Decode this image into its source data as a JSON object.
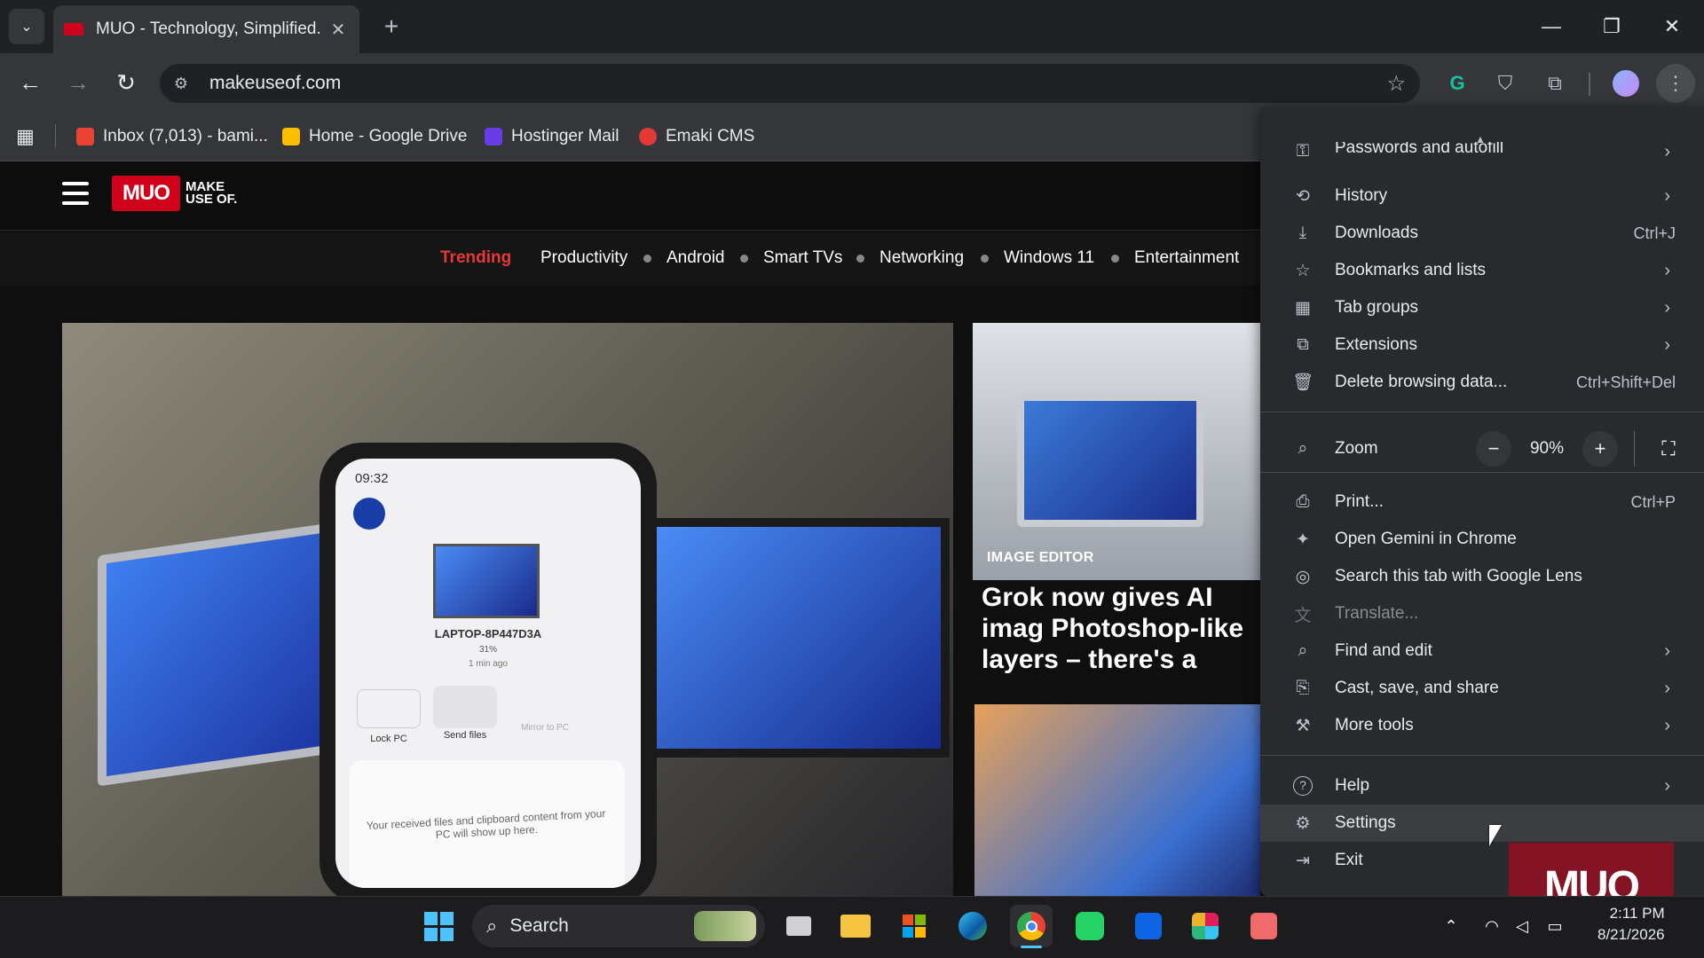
{
  "browser": {
    "tab_title": "MUO - Technology, Simplified.",
    "tab_close": "✕",
    "new_tab": "+",
    "url": "makeuseof.com",
    "window": {
      "minimize": "—",
      "restore": "❐",
      "close": "✕"
    }
  },
  "bookmarks": [
    {
      "label": "Inbox (7,013) - bami...",
      "color": "#ea4335"
    },
    {
      "label": "Home - Google Drive",
      "color": "#fbbc04"
    },
    {
      "label": "Hostinger Mail",
      "color": "#673de6"
    },
    {
      "label": "Emaki CMS",
      "color": "#e53935"
    }
  ],
  "site": {
    "logo_box": "MUO",
    "logo_text": "MAKE USE OF.",
    "nav": [
      "Trending",
      "Productivity",
      "Android",
      "Smart TVs",
      "Networking",
      "Windows 11",
      "Entertainment"
    ],
    "trending_color": "#e53935",
    "card1": {
      "tag": "IMAGE EDITOR",
      "title": "Grok now gives AI imag Photoshop-like layers – there's a catch"
    },
    "phone": {
      "time": "09:32",
      "device": "LAPTOP-8P447D3A",
      "battery": "31%",
      "ago": "1 min ago",
      "lock": "Lock PC",
      "send": "Send files",
      "mirror": "Mirror to PC",
      "received": "Your received files and clipboard content from your PC will show up here."
    }
  },
  "menu": {
    "partial_item": "Passwords and autofill",
    "items": [
      {
        "label": "History",
        "icon": "history-icon",
        "glyph": "⟲",
        "arrow": "›"
      },
      {
        "label": "Downloads",
        "icon": "download-icon",
        "glyph": "⤓",
        "shortcut": "Ctrl+J"
      },
      {
        "label": "Bookmarks and lists",
        "icon": "star-icon",
        "glyph": "☆",
        "arrow": "›"
      },
      {
        "label": "Tab groups",
        "icon": "grid-icon",
        "glyph": "▦",
        "arrow": "›"
      },
      {
        "label": "Extensions",
        "icon": "puzzle-icon",
        "glyph": "⧉",
        "arrow": "›"
      },
      {
        "label": "Delete browsing data...",
        "icon": "trash-icon",
        "glyph": "🗑",
        "shortcut": "Ctrl+Shift+Del"
      }
    ],
    "zoom": {
      "label": "Zoom",
      "minus": "−",
      "value": "90%",
      "plus": "+",
      "fullscreen": "⛶"
    },
    "items2": [
      {
        "label": "Print...",
        "icon": "printer-icon",
        "glyph": "⎙",
        "shortcut": "Ctrl+P"
      },
      {
        "label": "Open Gemini in Chrome",
        "icon": "sparkle-icon",
        "glyph": "✦"
      },
      {
        "label": "Search this tab with Google Lens",
        "icon": "lens-icon",
        "glyph": "◎"
      },
      {
        "label": "Translate...",
        "icon": "translate-icon",
        "glyph": "文",
        "disabled": true
      },
      {
        "label": "Find and edit",
        "icon": "find-icon",
        "glyph": "⌕",
        "arrow": "›"
      },
      {
        "label": "Cast, save, and share",
        "icon": "cast-icon",
        "glyph": "⎘",
        "arrow": "›"
      },
      {
        "label": "More tools",
        "icon": "toolbox-icon",
        "glyph": "⚒",
        "arrow": "›"
      }
    ],
    "items3": [
      {
        "label": "Help",
        "icon": "help-icon",
        "glyph": "?",
        "arrow": "›"
      },
      {
        "label": "Settings",
        "icon": "gear-icon",
        "glyph": "⚙"
      },
      {
        "label": "Exit",
        "icon": "exit-icon",
        "glyph": "⇥"
      }
    ]
  },
  "taskbar": {
    "search_label": "Search",
    "time": "2:11 PM",
    "date": "8/21/2026"
  },
  "watermark": "MUO"
}
